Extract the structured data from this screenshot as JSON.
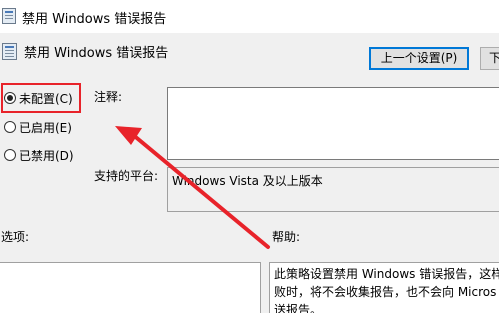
{
  "window": {
    "title": "禁用 Windows 错误报告"
  },
  "header": {
    "title": "禁用 Windows 错误报告"
  },
  "nav": {
    "prev_label": "上一个设置(P)",
    "next_label": "下"
  },
  "state": {
    "options": [
      {
        "label": "未配置(C)",
        "checked": true
      },
      {
        "label": "已启用(E)",
        "checked": false
      },
      {
        "label": "已禁用(D)",
        "checked": false
      }
    ]
  },
  "comment": {
    "label": "注释:",
    "value": ""
  },
  "platform": {
    "label": "支持的平台:",
    "value": "Windows Vista 及以上版本"
  },
  "options_section": {
    "label": "选项:"
  },
  "help_section": {
    "label": "帮助:",
    "lines": [
      "此策略设置禁用 Windows 错误报告，这样",
      "败时，将不会收集报告，也不会向 Micros",
      "送报告。"
    ]
  },
  "annotation": {
    "color": "#e8232a"
  }
}
